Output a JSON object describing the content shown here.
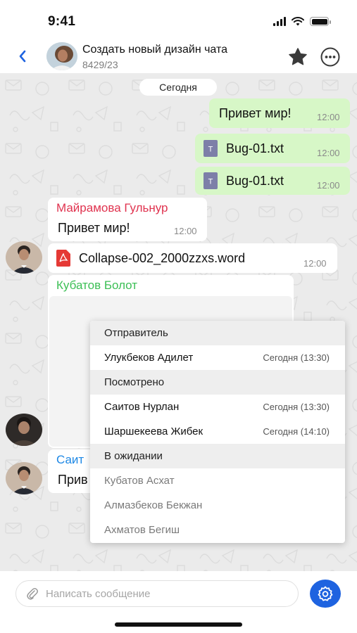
{
  "status": {
    "time": "9:41"
  },
  "header": {
    "title": "Создать новый дизайн чата",
    "subtitle": "8429/23"
  },
  "chat": {
    "date_label": "Сегодня",
    "outgoing": [
      {
        "text": "Привет мир!",
        "time": "12:00"
      },
      {
        "file": "Bug-01.txt",
        "time": "12:00"
      },
      {
        "file": "Bug-01.txt",
        "time": "12:00"
      }
    ],
    "incoming_1": {
      "sender": "Майрамова Гульнур",
      "text": "Привет мир!",
      "time": "12:00"
    },
    "incoming_2": {
      "file": "Collapse-002_2000zzxs.word",
      "time": "12:00"
    },
    "incoming_3": {
      "sender": "Кубатов Болот"
    },
    "incoming_4": {
      "sender_partial": "Саит",
      "text_partial": "Прив"
    }
  },
  "read_receipts": {
    "sender_label": "Отправитель",
    "sender": {
      "name": "Улукбеков Адилет",
      "time": "Сегодня (13:30)"
    },
    "viewed_label": "Посмотрено",
    "viewed": [
      {
        "name": "Саитов Нурлан",
        "time": "Сегодня (13:30)"
      },
      {
        "name": "Шаршекеева Жибек",
        "time": "Сегодня (14:10)"
      }
    ],
    "pending_label": "В ожидании",
    "pending": [
      {
        "name": "Кубатов Асхат"
      },
      {
        "name": "Алмазбеков Бекжан"
      },
      {
        "name": "Ахматов Бегиш"
      }
    ]
  },
  "composer": {
    "placeholder": "Написать сообщение"
  },
  "colors": {
    "accent": "#1e63e0",
    "outgoing_bubble": "#d7f7c7",
    "sender_red": "#e0334f",
    "sender_green": "#3cbf55",
    "sender_blue": "#1e88e5"
  }
}
